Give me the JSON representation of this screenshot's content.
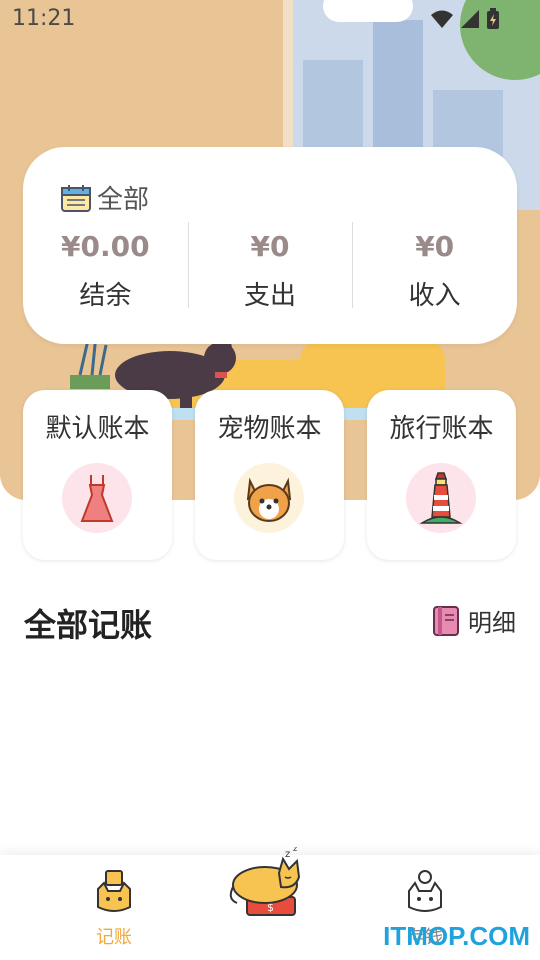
{
  "status_bar": {
    "time": "11:21"
  },
  "summary": {
    "title": "全部",
    "stats": [
      {
        "value": "¥0.00",
        "label": "结余"
      },
      {
        "value": "¥0",
        "label": "支出"
      },
      {
        "value": "¥0",
        "label": "收入"
      }
    ]
  },
  "ledgers": [
    {
      "name": "默认账本",
      "icon": "dress-icon",
      "bg": "#fde4ea"
    },
    {
      "name": "宠物账本",
      "icon": "dog-icon",
      "bg": "#fdf2dc"
    },
    {
      "name": "旅行账本",
      "icon": "lighthouse-icon",
      "bg": "#fde4ea"
    }
  ],
  "section": {
    "title": "全部记账",
    "detail_label": "明细"
  },
  "tabbar": {
    "tabs": [
      {
        "label": "记账",
        "icon": "cat-ledger-icon",
        "active": true
      },
      {
        "label": "",
        "icon": "sleeping-cat-add-icon",
        "active": false
      },
      {
        "label": "存钱",
        "icon": "cat-coin-icon",
        "active": false
      }
    ]
  },
  "colors": {
    "hero_bg": "#e9c596",
    "accent": "#f0a93b"
  },
  "watermark": "ITMOP.COM"
}
